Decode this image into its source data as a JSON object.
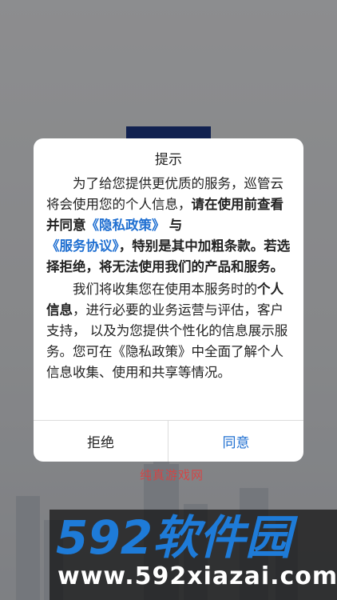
{
  "dialog": {
    "title": "提示",
    "para1": {
      "t1": "为了给您提供更优质的服务，巡管云将会使用您的个人信息，",
      "b1": "请在使用前查看并同意",
      "link1": "《隐私政策》",
      "b2": "与",
      "link2": "《服务协议》",
      "b3": "，特别是其中加粗条款。若选择拒绝，将无法使用我们的产品和服务。"
    },
    "para2": {
      "t1": "我们将收集您在使用本服务时的",
      "b1": "个人信息",
      "t2": "，进行必要的业务运营与评估，客户支持， 以及为您提供个性化的信息展示服务。您可在《隐私政策》中全面了解个人信息收集、使用和共享等情况。"
    },
    "reject_label": "拒绝",
    "agree_label": "同意"
  },
  "watermark": {
    "mid_text": "纯真游戏网",
    "logo_text": "592软件园",
    "url": "www.592xiazai.com"
  },
  "colors": {
    "accent": "#1f6fd1",
    "logo_blue": "#1e7bd8",
    "overlay": "#000000"
  }
}
